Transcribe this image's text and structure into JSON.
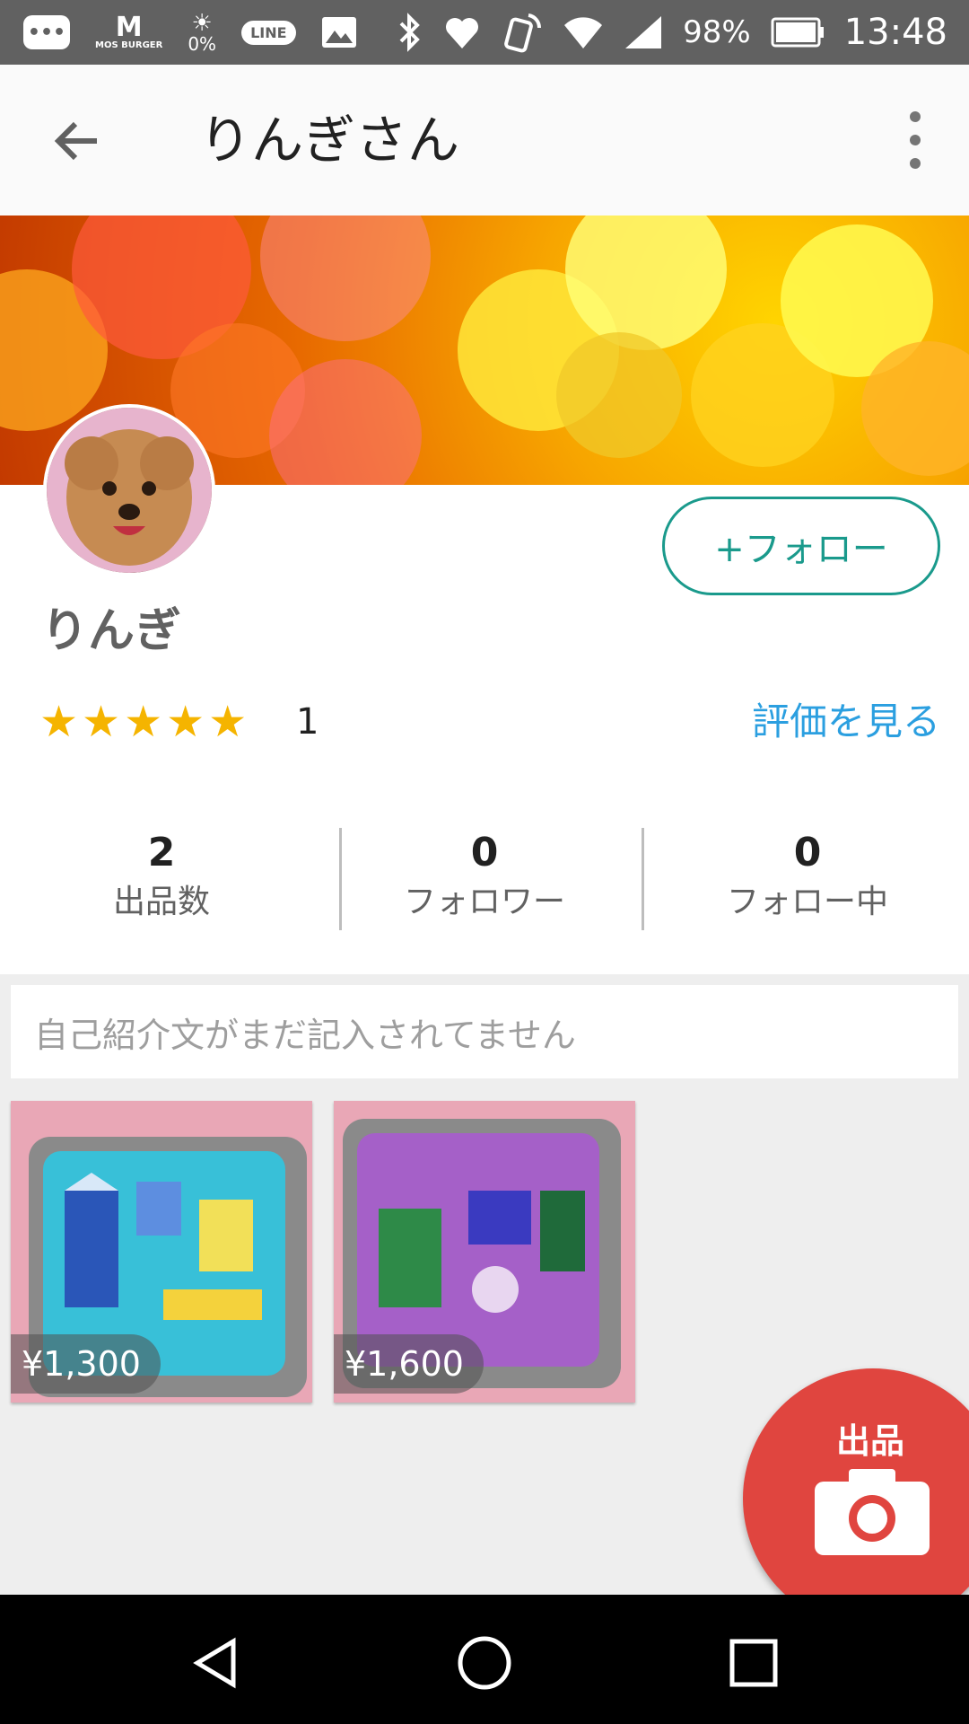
{
  "status_bar": {
    "time": "13:48",
    "battery": "98%",
    "weather_percent": "0%",
    "mos_label": "MOS BURGER",
    "line_label": "LINE",
    "icons": [
      "messages-icon",
      "mos-burger-icon",
      "weather-icon",
      "line-icon",
      "gallery-icon",
      "bluetooth-icon",
      "heart-icon",
      "nfc-icon",
      "wifi-icon",
      "signal-icon",
      "battery-icon"
    ]
  },
  "toolbar": {
    "title": "りんぎさん"
  },
  "profile": {
    "username": "りんぎ",
    "follow_label": "+フォロー",
    "rating_stars": 5,
    "rating_count": "1",
    "see_reviews": "評価を見る"
  },
  "stats": [
    {
      "value": "2",
      "label": "出品数"
    },
    {
      "value": "0",
      "label": "フォロワー"
    },
    {
      "value": "0",
      "label": "フォロー中"
    }
  ],
  "intro_placeholder": "自己紹介文がまだ記入されてません",
  "items": [
    {
      "price": "¥1,300",
      "color": "#38c0d8"
    },
    {
      "price": "¥1,600",
      "color": "#a560c8"
    }
  ],
  "fab": {
    "label": "出品"
  },
  "colors": {
    "accent": "#1a9a8c",
    "link": "#2b9fe0",
    "star": "#f5b400",
    "fab": "#e0453f"
  }
}
